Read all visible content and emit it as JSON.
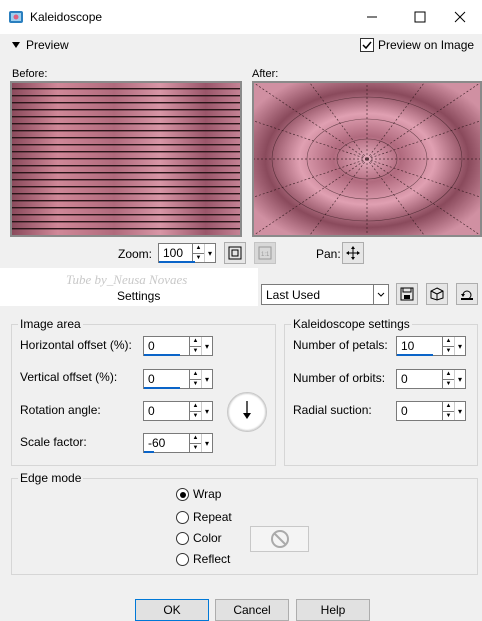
{
  "window": {
    "title": "Kaleidoscope"
  },
  "preview": {
    "toggle_label": "Preview",
    "preview_on_image_label": "Preview on Image",
    "preview_on_image_checked": true
  },
  "before_label": "Before:",
  "after_label": "After:",
  "zoom": {
    "label": "Zoom:",
    "value": "100"
  },
  "pan_label": "Pan:",
  "watermark": "Tube by_Neusa Novaes",
  "settings": {
    "label": "Settings",
    "selected": "Last Used"
  },
  "image_area": {
    "title": "Image area",
    "horizontal_offset": {
      "label": "Horizontal offset (%):",
      "value": "0"
    },
    "vertical_offset": {
      "label": "Vertical offset (%):",
      "value": "0"
    },
    "rotation_angle": {
      "label": "Rotation angle:",
      "value": "0"
    },
    "scale_factor": {
      "label": "Scale factor:",
      "value": "-60"
    }
  },
  "kaleidoscope": {
    "title": "Kaleidoscope settings",
    "petals": {
      "label": "Number of petals:",
      "value": "10"
    },
    "orbits": {
      "label": "Number of orbits:",
      "value": "0"
    },
    "radial_suction": {
      "label": "Radial suction:",
      "value": "0"
    }
  },
  "edge_mode": {
    "title": "Edge mode",
    "options": [
      "Wrap",
      "Repeat",
      "Color",
      "Reflect"
    ],
    "selected": "Wrap"
  },
  "buttons": {
    "ok": "OK",
    "cancel": "Cancel",
    "help": "Help"
  }
}
